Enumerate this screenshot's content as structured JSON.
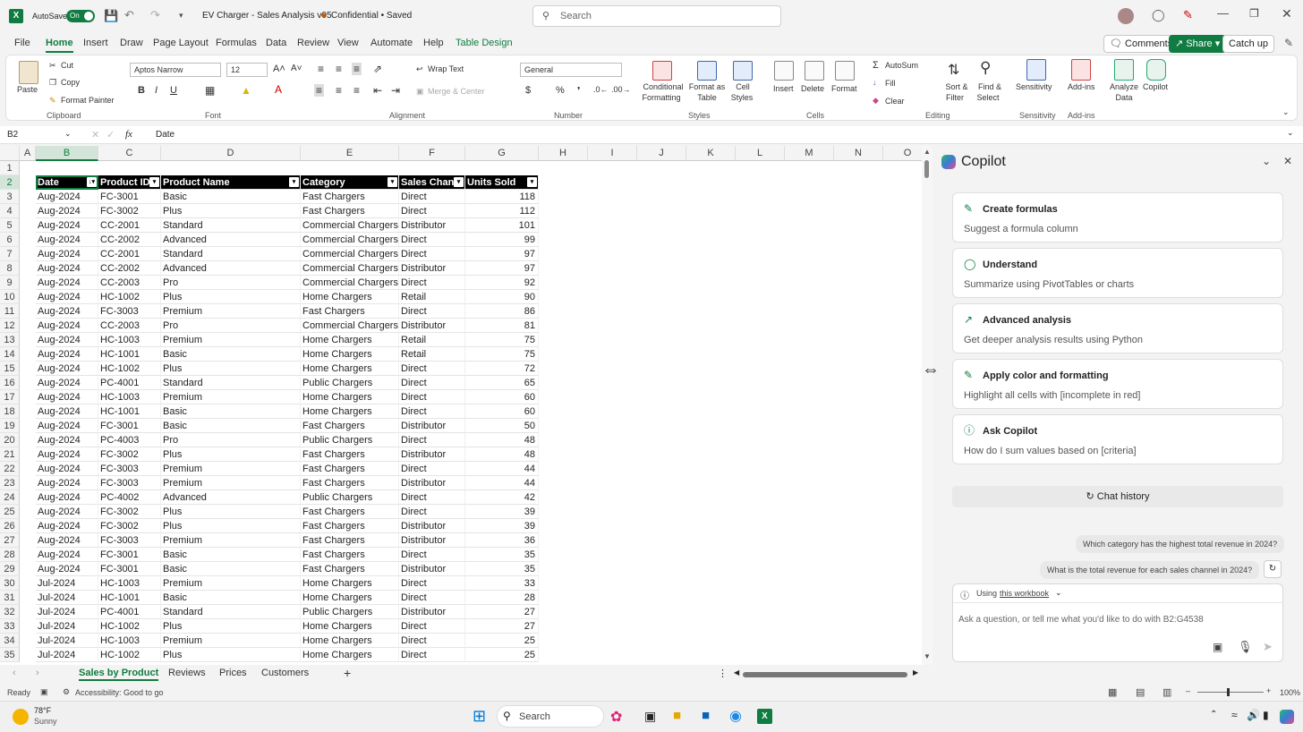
{
  "titlebar": {
    "autosave": "AutoSave",
    "toggle": "On",
    "filename": "EV Charger - Sales Analysis v05",
    "label": "Confidential • Saved",
    "search": "Search"
  },
  "tabs": [
    "File",
    "Home",
    "Insert",
    "Draw",
    "Page Layout",
    "Formulas",
    "Data",
    "Review",
    "View",
    "Automate",
    "Help",
    "Table Design"
  ],
  "top_buttons": {
    "comments": "Comments",
    "share": "Share",
    "catchup": "Catch up"
  },
  "ribbon": {
    "paste": "Paste",
    "cut": "Cut",
    "copy": "Copy",
    "format_painter": "Format Painter",
    "clipboard": "Clipboard",
    "font_name": "Aptos Narrow",
    "font_size": "12",
    "font": "Font",
    "wrap_text": "Wrap Text",
    "merge_center": "Merge & Center",
    "alignment": "Alignment",
    "number_format": "General",
    "number": "Number",
    "cond_fmt1": "Conditional",
    "cond_fmt2": "Formatting",
    "fmt_table1": "Format as",
    "fmt_table2": "Table",
    "cell_styles1": "Cell",
    "cell_styles2": "Styles",
    "styles": "Styles",
    "insert": "Insert",
    "delete": "Delete",
    "format": "Format",
    "cells": "Cells",
    "autosum": "AutoSum",
    "fill": "Fill",
    "clear": "Clear",
    "sort1": "Sort &",
    "sort2": "Filter",
    "find1": "Find &",
    "find2": "Select",
    "editing": "Editing",
    "sensitivity": "Sensitivity",
    "sensitivity_grp": "Sensitivity",
    "addins": "Add-ins",
    "addins_grp": "Add-ins",
    "analyze1": "Analyze",
    "analyze2": "Data",
    "copilot": "Copilot"
  },
  "formula_bar": {
    "name_box": "B2",
    "fx": "fx",
    "content": "Date"
  },
  "columns": [
    "A",
    "B",
    "C",
    "D",
    "E",
    "F",
    "G",
    "H",
    "I",
    "J",
    "K",
    "L",
    "M",
    "N",
    "O"
  ],
  "table_headers": [
    "Date",
    "Product ID",
    "Product Name",
    "Category",
    "Sales Chann",
    "Units Sold"
  ],
  "rows": [
    [
      "Aug-2024",
      "FC-3001",
      "Basic",
      "Fast Chargers",
      "Direct",
      "118"
    ],
    [
      "Aug-2024",
      "FC-3002",
      "Plus",
      "Fast Chargers",
      "Direct",
      "112"
    ],
    [
      "Aug-2024",
      "CC-2001",
      "Standard",
      "Commercial Chargers",
      "Distributor",
      "101"
    ],
    [
      "Aug-2024",
      "CC-2002",
      "Advanced",
      "Commercial Chargers",
      "Direct",
      "99"
    ],
    [
      "Aug-2024",
      "CC-2001",
      "Standard",
      "Commercial Chargers",
      "Direct",
      "97"
    ],
    [
      "Aug-2024",
      "CC-2002",
      "Advanced",
      "Commercial Chargers",
      "Distributor",
      "97"
    ],
    [
      "Aug-2024",
      "CC-2003",
      "Pro",
      "Commercial Chargers",
      "Direct",
      "92"
    ],
    [
      "Aug-2024",
      "HC-1002",
      "Plus",
      "Home Chargers",
      "Retail",
      "90"
    ],
    [
      "Aug-2024",
      "FC-3003",
      "Premium",
      "Fast Chargers",
      "Direct",
      "86"
    ],
    [
      "Aug-2024",
      "CC-2003",
      "Pro",
      "Commercial Chargers",
      "Distributor",
      "81"
    ],
    [
      "Aug-2024",
      "HC-1003",
      "Premium",
      "Home Chargers",
      "Retail",
      "75"
    ],
    [
      "Aug-2024",
      "HC-1001",
      "Basic",
      "Home Chargers",
      "Retail",
      "75"
    ],
    [
      "Aug-2024",
      "HC-1002",
      "Plus",
      "Home Chargers",
      "Direct",
      "72"
    ],
    [
      "Aug-2024",
      "PC-4001",
      "Standard",
      "Public Chargers",
      "Direct",
      "65"
    ],
    [
      "Aug-2024",
      "HC-1003",
      "Premium",
      "Home Chargers",
      "Direct",
      "60"
    ],
    [
      "Aug-2024",
      "HC-1001",
      "Basic",
      "Home Chargers",
      "Direct",
      "60"
    ],
    [
      "Aug-2024",
      "FC-3001",
      "Basic",
      "Fast Chargers",
      "Distributor",
      "50"
    ],
    [
      "Aug-2024",
      "PC-4003",
      "Pro",
      "Public Chargers",
      "Direct",
      "48"
    ],
    [
      "Aug-2024",
      "FC-3002",
      "Plus",
      "Fast Chargers",
      "Distributor",
      "48"
    ],
    [
      "Aug-2024",
      "FC-3003",
      "Premium",
      "Fast Chargers",
      "Direct",
      "44"
    ],
    [
      "Aug-2024",
      "FC-3003",
      "Premium",
      "Fast Chargers",
      "Distributor",
      "44"
    ],
    [
      "Aug-2024",
      "PC-4002",
      "Advanced",
      "Public Chargers",
      "Direct",
      "42"
    ],
    [
      "Aug-2024",
      "FC-3002",
      "Plus",
      "Fast Chargers",
      "Direct",
      "39"
    ],
    [
      "Aug-2024",
      "FC-3002",
      "Plus",
      "Fast Chargers",
      "Distributor",
      "39"
    ],
    [
      "Aug-2024",
      "FC-3003",
      "Premium",
      "Fast Chargers",
      "Distributor",
      "36"
    ],
    [
      "Aug-2024",
      "FC-3001",
      "Basic",
      "Fast Chargers",
      "Direct",
      "35"
    ],
    [
      "Aug-2024",
      "FC-3001",
      "Basic",
      "Fast Chargers",
      "Distributor",
      "35"
    ],
    [
      "Jul-2024",
      "HC-1003",
      "Premium",
      "Home Chargers",
      "Direct",
      "33"
    ],
    [
      "Jul-2024",
      "HC-1001",
      "Basic",
      "Home Chargers",
      "Direct",
      "28"
    ],
    [
      "Jul-2024",
      "PC-4001",
      "Standard",
      "Public Chargers",
      "Distributor",
      "27"
    ],
    [
      "Jul-2024",
      "HC-1002",
      "Plus",
      "Home Chargers",
      "Direct",
      "27"
    ],
    [
      "Jul-2024",
      "HC-1003",
      "Premium",
      "Home Chargers",
      "Direct",
      "25"
    ],
    [
      "Jul-2024",
      "HC-1002",
      "Plus",
      "Home Chargers",
      "Direct",
      "25"
    ]
  ],
  "sheet_tabs": [
    "Sales by Product",
    "Reviews",
    "Prices",
    "Customers"
  ],
  "status": {
    "ready": "Ready",
    "accessibility": "Accessibility: Good to go",
    "zoom": "100%"
  },
  "copilot": {
    "title": "Copilot",
    "cards": [
      {
        "title": "Create formulas",
        "sub": "Suggest a formula column"
      },
      {
        "title": "Understand",
        "sub": "Summarize using PivotTables or charts"
      },
      {
        "title": "Advanced analysis",
        "sub": "Get deeper analysis results using Python"
      },
      {
        "title": "Apply color and formatting",
        "sub": "Highlight all cells with [incomplete in red]"
      },
      {
        "title": "Ask Copilot",
        "sub": "How do I sum values based on [criteria]"
      }
    ],
    "chat_history": "Chat history",
    "suggestion1": "Which category has the highest total revenue in 2024?",
    "suggestion2": "What is the total revenue for each sales channel in 2024?",
    "using": "Using",
    "workbook": "this workbook",
    "input_placeholder": "Ask a question, or tell me what you'd like to do with B2:G4538"
  },
  "taskbar": {
    "temp": "78°F",
    "weather": "Sunny",
    "search": "Search"
  }
}
